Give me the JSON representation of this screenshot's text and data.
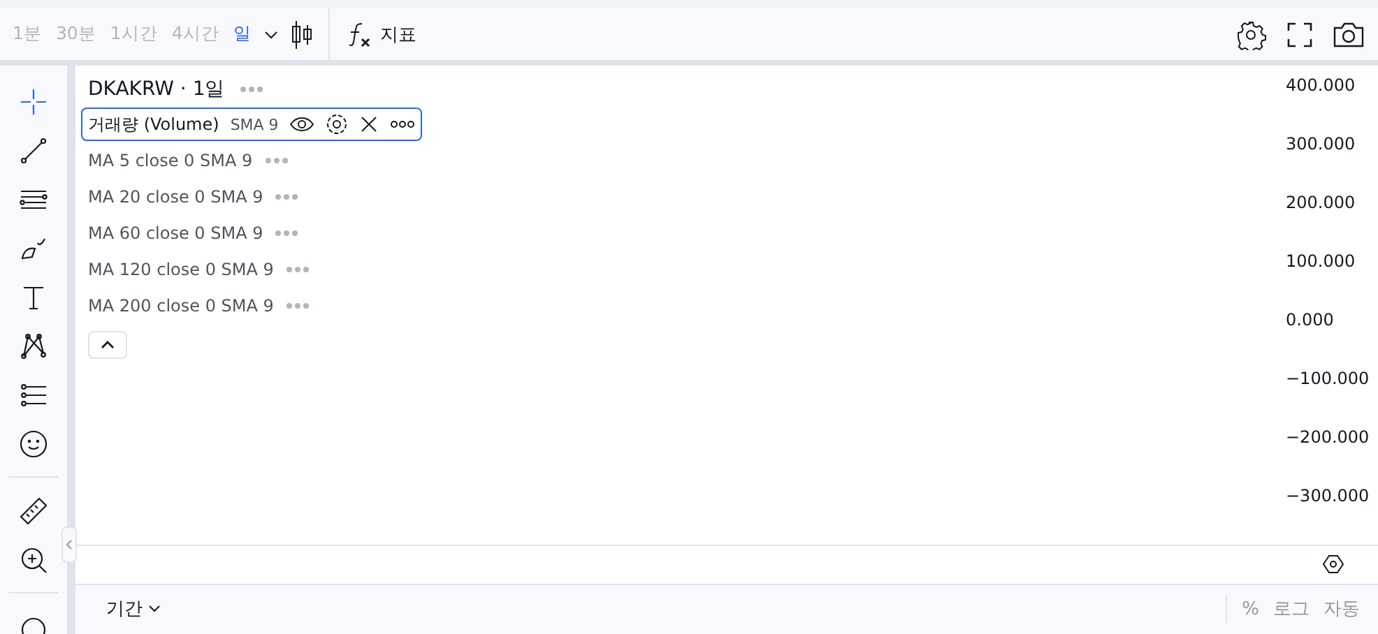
{
  "toolbar": {
    "intervals": [
      {
        "label": "1분",
        "selected": false,
        "disabled": true
      },
      {
        "label": "30분",
        "selected": false,
        "disabled": true
      },
      {
        "label": "1시간",
        "selected": false,
        "disabled": true
      },
      {
        "label": "4시간",
        "selected": false,
        "disabled": true
      },
      {
        "label": "일",
        "selected": true,
        "disabled": false
      }
    ],
    "indicators_label": "지표"
  },
  "tools": [
    {
      "kind": "crosshair",
      "selected": true
    },
    {
      "kind": "trendline",
      "selected": false
    },
    {
      "kind": "hlines",
      "selected": false
    },
    {
      "kind": "brush",
      "selected": false
    },
    {
      "kind": "text",
      "selected": false
    },
    {
      "kind": "pattern",
      "selected": false
    },
    {
      "kind": "fib",
      "selected": false
    },
    {
      "kind": "emoji",
      "selected": false
    },
    {
      "kind": "divider"
    },
    {
      "kind": "ruler",
      "selected": false
    },
    {
      "kind": "zoom",
      "selected": false
    },
    {
      "kind": "divider"
    },
    {
      "kind": "partial",
      "selected": false
    }
  ],
  "legend": {
    "title": "DKAKRW · 1일",
    "studies": [
      {
        "name": "거래량 (Volume)",
        "params": "SMA 9",
        "selected": true
      },
      {
        "name": "MA 5 close 0 SMA 9",
        "selected": false
      },
      {
        "name": "MA 20 close 0 SMA 9",
        "selected": false
      },
      {
        "name": "MA 60 close 0 SMA 9",
        "selected": false
      },
      {
        "name": "MA 120 close 0 SMA 9",
        "selected": false
      },
      {
        "name": "MA 200 close 0 SMA 9",
        "selected": false
      }
    ]
  },
  "price_axis": [
    "400.000",
    "300.000",
    "200.000",
    "100.000",
    "0.000",
    "−100.000",
    "−200.000",
    "−300.000"
  ],
  "bottom_bar": {
    "range_label": "기간",
    "scale_options": [
      "%",
      "로그",
      "자동"
    ]
  }
}
